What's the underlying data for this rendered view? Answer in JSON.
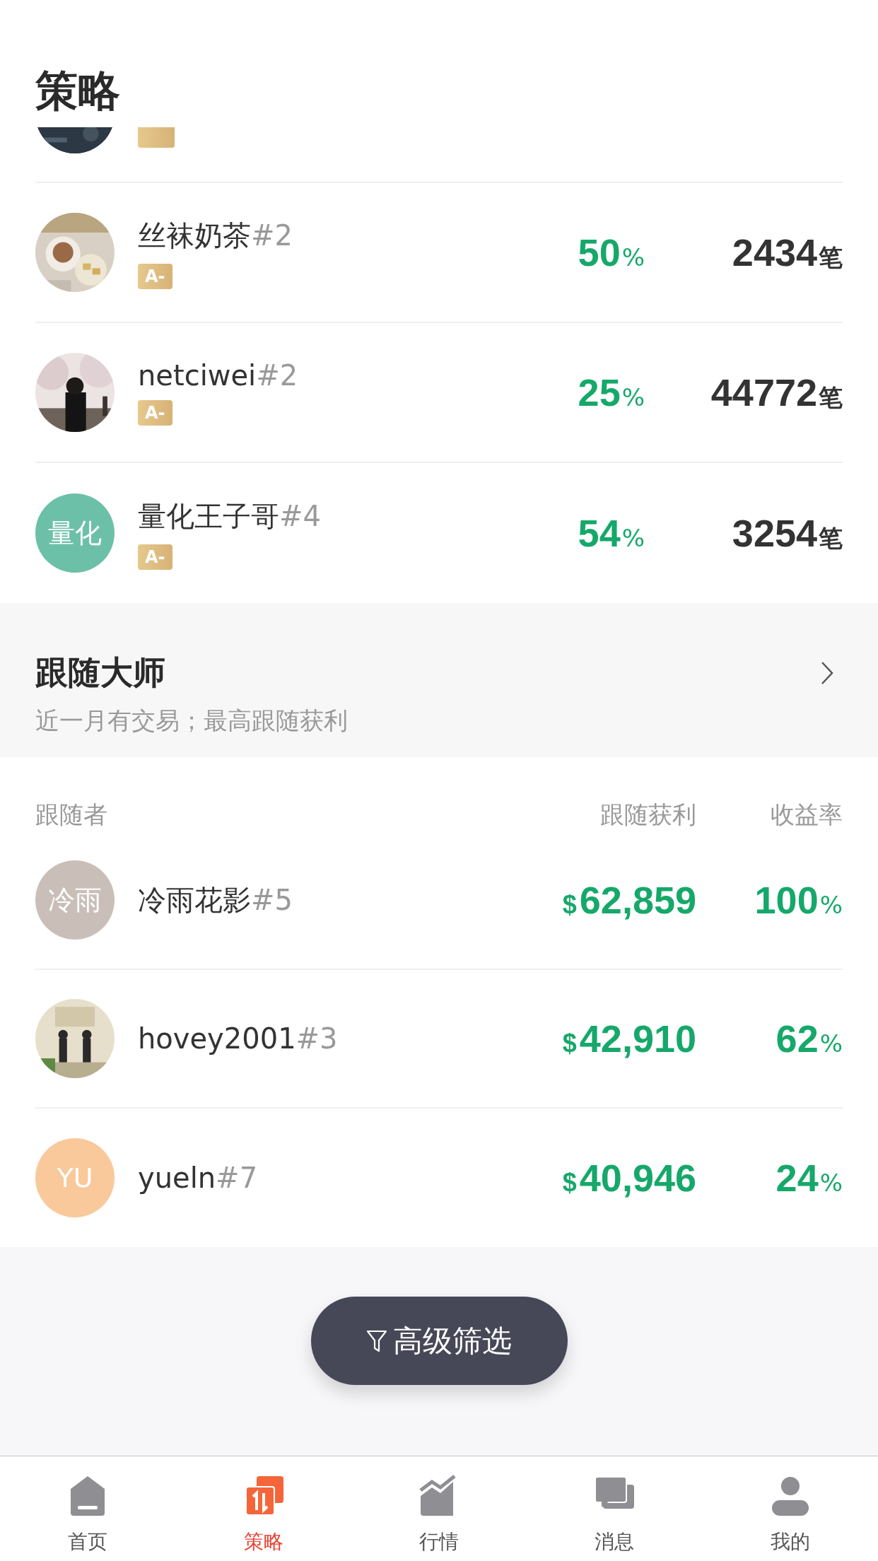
{
  "header": {
    "title": "策略"
  },
  "strategies": {
    "clipped_row": {
      "badge": true
    },
    "rows": [
      {
        "name": "丝袜奶茶",
        "rank": "#2",
        "badge": "A-",
        "rate": "50",
        "rate_unit": "%",
        "trades": "2434",
        "trades_unit": "笔"
      },
      {
        "name": "netciwei",
        "rank": "#2",
        "badge": "A-",
        "rate": "25",
        "rate_unit": "%",
        "trades": "44772",
        "trades_unit": "笔"
      },
      {
        "avatar": {
          "kind": "text",
          "text": "量化",
          "color": "#6cc0a8"
        },
        "name": "量化王子哥",
        "rank": "#4",
        "badge": "A-",
        "rate": "54",
        "rate_unit": "%",
        "trades": "3254",
        "trades_unit": "笔"
      }
    ]
  },
  "follow_masters": {
    "title": "跟随大师",
    "subtitle": "近一月有交易；最高跟随获利",
    "columns": [
      "跟随者",
      "跟随获利",
      "收益率"
    ],
    "rows": [
      {
        "avatar": {
          "kind": "text",
          "text": "冷雨",
          "color": "#c9bfb8"
        },
        "name": "冷雨花影",
        "rank": "#5",
        "currency": "$",
        "profit": "62,859",
        "rate": "100",
        "rate_unit": "%"
      },
      {
        "name": "hovey2001",
        "rank": "#3",
        "currency": "$",
        "profit": "42,910",
        "rate": "62",
        "rate_unit": "%"
      },
      {
        "avatar": {
          "kind": "text",
          "text": "YU",
          "color": "#f9c99b"
        },
        "name": "yueln",
        "rank": "#7",
        "currency": "$",
        "profit": "40,946",
        "rate": "24",
        "rate_unit": "%"
      }
    ]
  },
  "filter_button": {
    "label": "高级筛选"
  },
  "tab_bar": [
    {
      "label": "首页",
      "selected": false
    },
    {
      "label": "策略",
      "selected": true
    },
    {
      "label": "行情",
      "selected": false
    },
    {
      "label": "消息",
      "selected": false
    },
    {
      "label": "我的",
      "selected": false
    }
  ]
}
